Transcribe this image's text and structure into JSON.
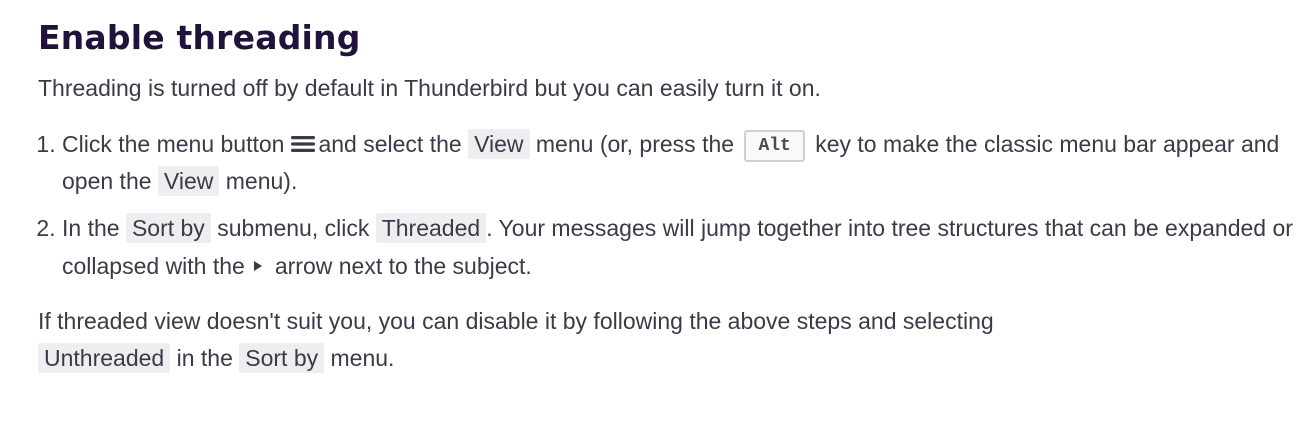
{
  "article": {
    "title": "Enable threading",
    "intro": "Threading is turned off by default in Thunderbird but you can easily turn it on.",
    "steps": [
      {
        "t1": "Click the menu button",
        "icon": "hamburger-menu-icon",
        "t2": "and select the",
        "ui1": "View",
        "t3": "menu (or, press the",
        "key": "Alt",
        "t4": "key to make the classic menu bar appear and open the",
        "ui2": "View",
        "t5": "menu)."
      },
      {
        "t1": "In the",
        "ui1": "Sort by",
        "t2": "submenu, click",
        "ui2": "Threaded",
        "t3": ". Your messages will jump together into tree structures that can be expanded or collapsed with the",
        "icon": "expand-arrow-icon",
        "t4": "arrow next to the subject."
      }
    ],
    "outro": {
      "t1": "If threaded view doesn't suit you, you can disable it by following the above steps and selecting",
      "ui1": "Unthreaded",
      "t2": "in the",
      "ui2": "Sort by",
      "t3": "menu."
    }
  },
  "colors": {
    "heading": "#20123a",
    "text": "#3b3a48",
    "ui_highlight": "#eeeef0",
    "kbd_border": "#cfcfd8"
  }
}
